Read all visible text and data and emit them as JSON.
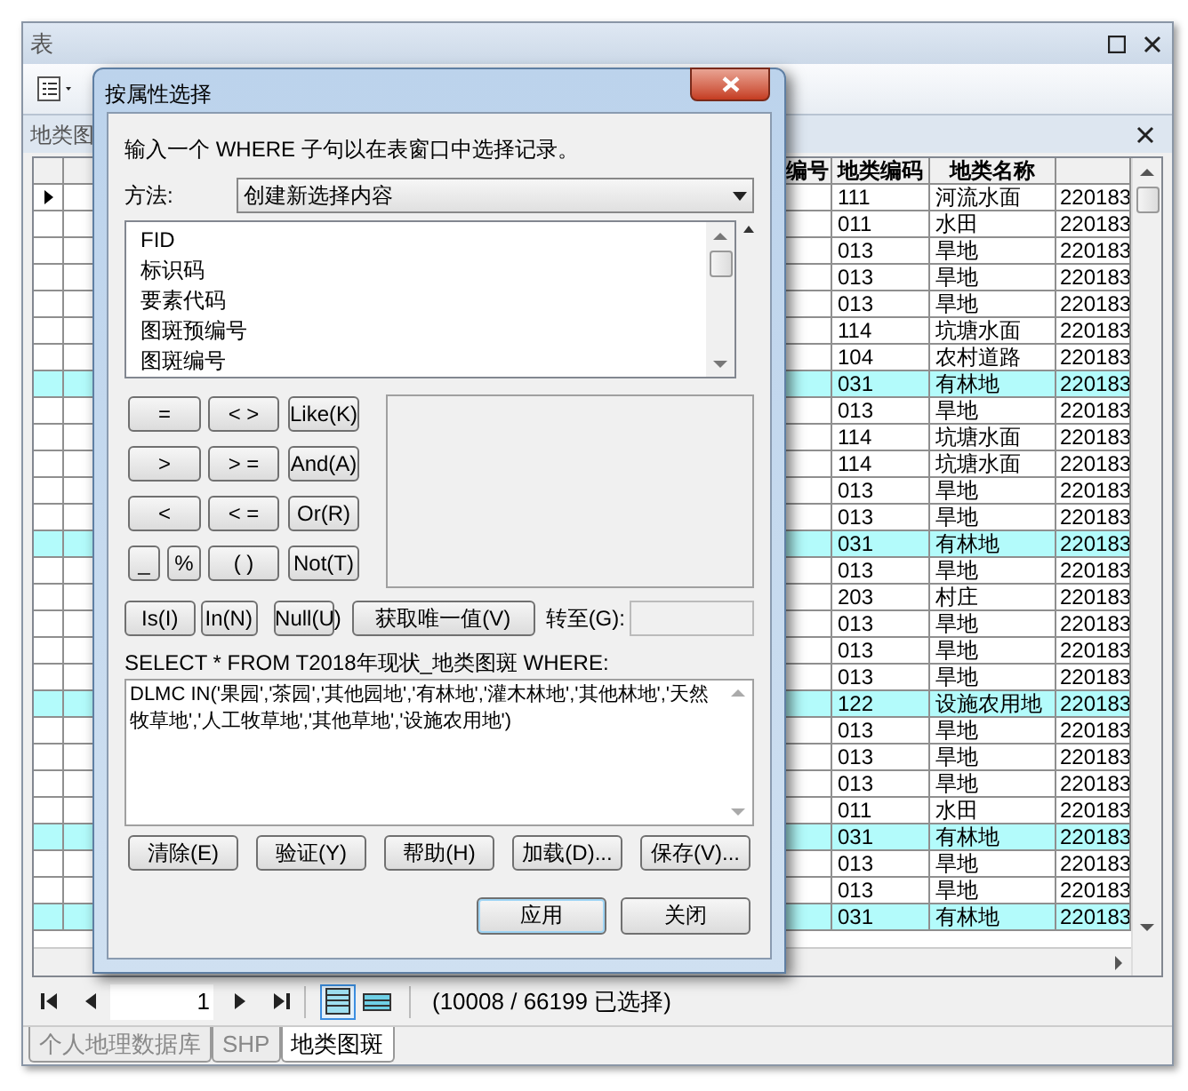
{
  "window": {
    "title": "表"
  },
  "table_window": {
    "title": "地类图",
    "columns": [
      "编号",
      "地类编码",
      "地类名称"
    ],
    "rows": [
      {
        "code": "111",
        "name": "河流水面",
        "column_4": "220183",
        "selected": false,
        "current": true
      },
      {
        "code": "011",
        "name": "水田",
        "column_4": "220183",
        "selected": false,
        "current": false
      },
      {
        "code": "013",
        "name": "旱地",
        "column_4": "220183",
        "selected": false,
        "current": false
      },
      {
        "code": "013",
        "name": "旱地",
        "column_4": "220183",
        "selected": false,
        "current": false
      },
      {
        "code": "013",
        "name": "旱地",
        "column_4": "220183",
        "selected": false,
        "current": false
      },
      {
        "code": "114",
        "name": "坑塘水面",
        "column_4": "220183",
        "selected": false,
        "current": false
      },
      {
        "code": "104",
        "name": "农村道路",
        "column_4": "220183",
        "selected": false,
        "current": false
      },
      {
        "code": "031",
        "name": "有林地",
        "column_4": "220183",
        "selected": true,
        "current": false
      },
      {
        "code": "013",
        "name": "旱地",
        "column_4": "220183",
        "selected": false,
        "current": false
      },
      {
        "code": "114",
        "name": "坑塘水面",
        "column_4": "220183",
        "selected": false,
        "current": false
      },
      {
        "code": "114",
        "name": "坑塘水面",
        "column_4": "220183",
        "selected": false,
        "current": false
      },
      {
        "code": "013",
        "name": "旱地",
        "column_4": "220183",
        "selected": false,
        "current": false
      },
      {
        "code": "013",
        "name": "旱地",
        "column_4": "220183",
        "selected": false,
        "current": false
      },
      {
        "code": "031",
        "name": "有林地",
        "column_4": "220183",
        "selected": true,
        "current": false
      },
      {
        "code": "013",
        "name": "旱地",
        "column_4": "220183",
        "selected": false,
        "current": false
      },
      {
        "code": "203",
        "name": "村庄",
        "column_4": "220183",
        "selected": false,
        "current": false
      },
      {
        "code": "013",
        "name": "旱地",
        "column_4": "220183",
        "selected": false,
        "current": false
      },
      {
        "code": "013",
        "name": "旱地",
        "column_4": "220183",
        "selected": false,
        "current": false
      },
      {
        "code": "013",
        "name": "旱地",
        "column_4": "220183",
        "selected": false,
        "current": false
      },
      {
        "code": "122",
        "name": "设施农用地",
        "column_4": "220183",
        "selected": true,
        "current": false
      },
      {
        "code": "013",
        "name": "旱地",
        "column_4": "220183",
        "selected": false,
        "current": false
      },
      {
        "code": "013",
        "name": "旱地",
        "column_4": "220183",
        "selected": false,
        "current": false
      },
      {
        "code": "013",
        "name": "旱地",
        "column_4": "220183",
        "selected": false,
        "current": false
      },
      {
        "code": "011",
        "name": "水田",
        "column_4": "220183",
        "selected": false,
        "current": false
      },
      {
        "code": "031",
        "name": "有林地",
        "column_4": "220183",
        "selected": true,
        "current": false
      },
      {
        "code": "013",
        "name": "旱地",
        "column_4": "220183",
        "selected": false,
        "current": false
      },
      {
        "code": "013",
        "name": "旱地",
        "column_4": "220183",
        "selected": false,
        "current": false
      },
      {
        "code": "031",
        "name": "有林地",
        "column_4": "220183",
        "selected": true,
        "current": false
      }
    ],
    "record": "1",
    "views": [
      {
        "selected": true
      },
      {
        "selected": false
      }
    ],
    "status": "(10008 / 66199 已选择)",
    "tabs": [
      {
        "label": "个人地理数据库",
        "selected": false
      },
      {
        "label": "SHP",
        "selected": false
      },
      {
        "label": "地类图斑",
        "selected": true
      }
    ]
  },
  "dialog": {
    "title": "按属性选择",
    "prompt": "输入一个 WHERE 子句以在表窗口中选择记录。",
    "method_label": "方法:",
    "method": "创建新选择内容",
    "fields": [
      "FID",
      "标识码",
      "要素代码",
      "图斑预编号",
      "图斑编号"
    ],
    "operators": [
      [
        "=",
        "< >",
        "Like(K)"
      ],
      [
        ">",
        "> =",
        "And(A)"
      ],
      [
        "<",
        "< =",
        "Or(R)"
      ],
      [
        "_",
        "%",
        "( )",
        "Not(T)"
      ]
    ],
    "value_buttons": [
      "Is(I)",
      "In(N)",
      "Null(U)",
      "获取唯一值(V)"
    ],
    "goto_label": "转至(G):",
    "query_prefix": "SELECT * FROM T2018年现状_地类图斑 WHERE:",
    "expression": "DLMC IN('果园','茶园','其他园地','有林地','灌木林地','其他林地','天然牧草地','人工牧草地','其他草地','设施农用地')",
    "actions": [
      "清除(E)",
      "验证(Y)",
      "帮助(H)",
      "加载(D)...",
      "保存(V)..."
    ],
    "buttons": [
      {
        "label": "应用",
        "focused": true
      },
      {
        "label": "关闭",
        "focused": false
      }
    ]
  }
}
